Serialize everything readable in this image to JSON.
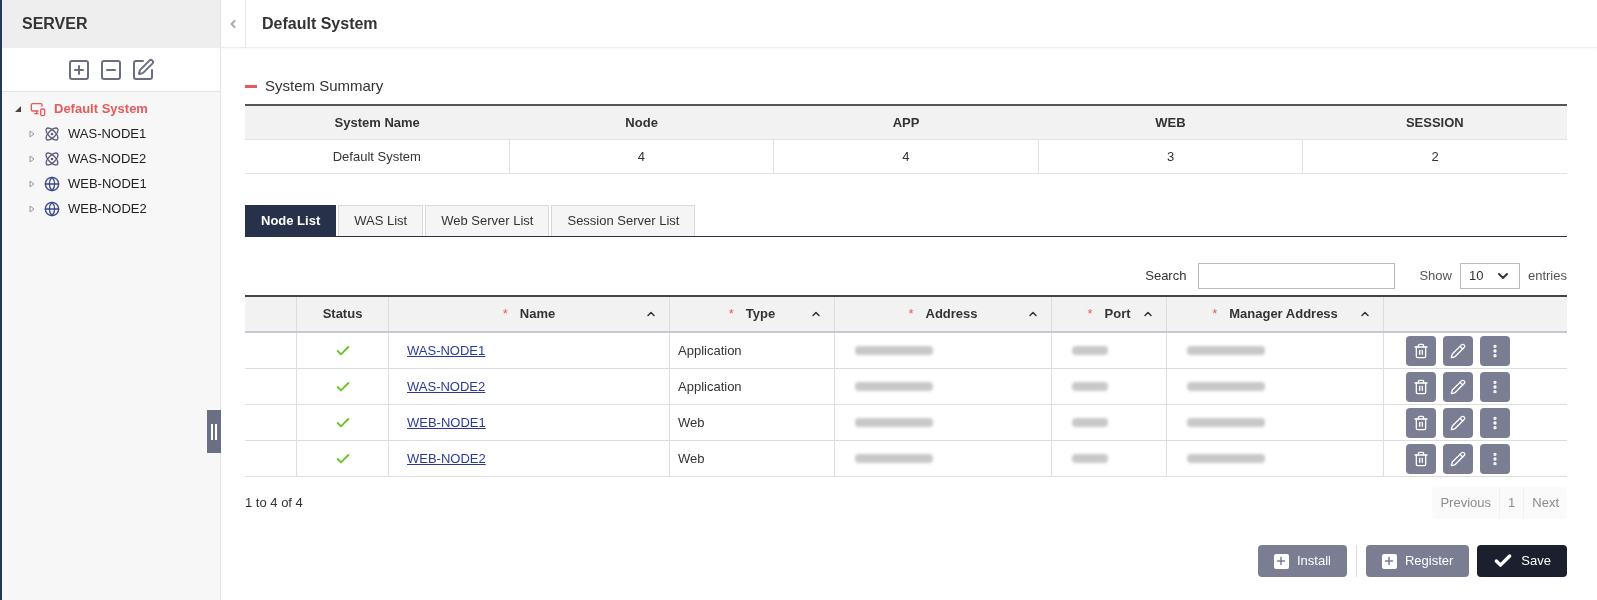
{
  "sidebar": {
    "title": "SERVER",
    "tree": [
      {
        "label": "Default System",
        "kind": "system",
        "selected": true,
        "expanded": true,
        "children": [
          {
            "label": "WAS-NODE1",
            "kind": "was",
            "selected": false,
            "expanded": false
          },
          {
            "label": "WAS-NODE2",
            "kind": "was",
            "selected": false,
            "expanded": false
          },
          {
            "label": "WEB-NODE1",
            "kind": "web",
            "selected": false,
            "expanded": false
          },
          {
            "label": "WEB-NODE2",
            "kind": "web",
            "selected": false,
            "expanded": false
          }
        ]
      }
    ]
  },
  "header": {
    "title": "Default System"
  },
  "summary": {
    "title": "System Summary",
    "expanded": true,
    "columns": [
      "System Name",
      "Node",
      "APP",
      "WEB",
      "SESSION"
    ],
    "row": [
      "Default System",
      "4",
      "4",
      "3",
      "2"
    ]
  },
  "tabs": [
    {
      "label": "Node List",
      "selected": true
    },
    {
      "label": "WAS List",
      "selected": false
    },
    {
      "label": "Web Server List",
      "selected": false
    },
    {
      "label": "Session Server List",
      "selected": false
    }
  ],
  "search": {
    "label": "Search"
  },
  "page_size": {
    "label_before": "Show",
    "value": "10",
    "label_after": "entries"
  },
  "table": {
    "columns": [
      {
        "label": "Status",
        "sortable": false
      },
      {
        "label": "Name",
        "required_mark": "*",
        "sortable": true
      },
      {
        "label": "Type",
        "required_mark": "*",
        "sortable": true
      },
      {
        "label": "Address",
        "required_mark": "*",
        "sortable": true
      },
      {
        "label": "Port",
        "required_mark": "*",
        "sortable": true
      },
      {
        "label": "Manager Address",
        "required_mark": "*",
        "sortable": true
      }
    ],
    "rows": [
      {
        "healthy": true,
        "name": "WAS-NODE1",
        "type": "Application"
      },
      {
        "healthy": true,
        "name": "WAS-NODE2",
        "type": "Application"
      },
      {
        "healthy": true,
        "name": "WEB-NODE1",
        "type": "Web"
      },
      {
        "healthy": true,
        "name": "WEB-NODE2",
        "type": "Web"
      }
    ]
  },
  "info": "1 to 4 of 4",
  "pagination": [
    {
      "label": "Previous",
      "disabled": true
    },
    {
      "label": "1",
      "disabled": true
    },
    {
      "label": "Next",
      "disabled": true
    }
  ],
  "buttons": [
    {
      "label": "Install",
      "kind": "add"
    },
    {
      "label": "Register",
      "kind": "add"
    },
    {
      "label": "Save",
      "kind": "save"
    }
  ]
}
